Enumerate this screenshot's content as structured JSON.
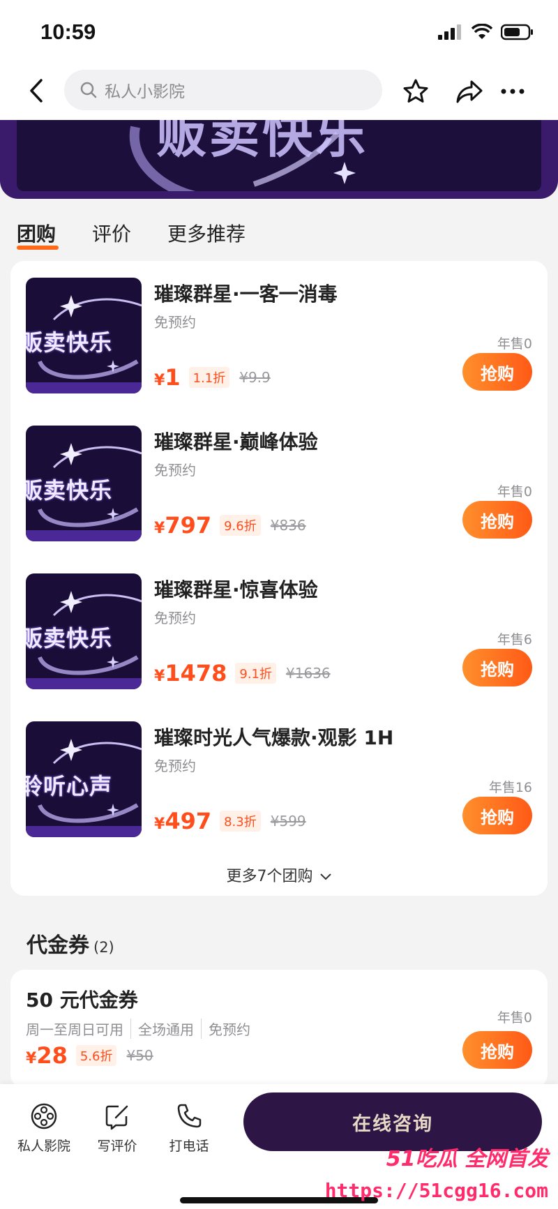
{
  "status_bar": {
    "time": "10:59"
  },
  "nav": {
    "search_placeholder": "私人小影院"
  },
  "banner": {
    "text": "贩卖快乐"
  },
  "tabs": [
    {
      "label": "团购",
      "active": true
    },
    {
      "label": "评价",
      "active": false
    },
    {
      "label": "更多推荐",
      "active": false
    }
  ],
  "deals": [
    {
      "title": "璀璨群星·一客一消毒",
      "subtitle": "免预约",
      "currency": "¥",
      "price": "1",
      "discount": "1.1折",
      "original": "¥9.9",
      "sold": "年售0",
      "button": "抢购",
      "thumb_text": "贩卖快乐"
    },
    {
      "title": "璀璨群星·巅峰体验",
      "subtitle": "免预约",
      "currency": "¥",
      "price": "797",
      "discount": "9.6折",
      "original": "¥836",
      "sold": "年售0",
      "button": "抢购",
      "thumb_text": "贩卖快乐"
    },
    {
      "title": "璀璨群星·惊喜体验",
      "subtitle": "免预约",
      "currency": "¥",
      "price": "1478",
      "discount": "9.1折",
      "original": "¥1636",
      "sold": "年售6",
      "button": "抢购",
      "thumb_text": "贩卖快乐"
    },
    {
      "title": "璀璨时光人气爆款·观影 1H",
      "subtitle": "免预约",
      "currency": "¥",
      "price": "497",
      "discount": "8.3折",
      "original": "¥599",
      "sold": "年售16",
      "button": "抢购",
      "thumb_text": "聆听心声"
    }
  ],
  "more_deals": "更多7个团购",
  "vouchers": {
    "heading": "代金券",
    "count": "(2)",
    "items": [
      {
        "title": "50 元代金券",
        "tags": [
          "周一至周日可用",
          "全场通用",
          "免预约"
        ],
        "currency": "¥",
        "price": "28",
        "discount": "5.6折",
        "original": "¥50",
        "sold": "年售0",
        "button": "抢购"
      }
    ]
  },
  "bottom_bar": {
    "items": [
      {
        "label": "私人影院",
        "icon": "film-reel-icon"
      },
      {
        "label": "写评价",
        "icon": "edit-review-icon"
      },
      {
        "label": "打电话",
        "icon": "phone-icon"
      }
    ],
    "consult": "在线咨询"
  },
  "watermark": {
    "line1": "51吃瓜 全网首发",
    "line2": "https://51cgg16.com"
  },
  "colors": {
    "accent": "#ff5a16",
    "price": "#ff4d1c",
    "consult_bg": "#2d1545",
    "thumb_bg": "#1a0d38"
  }
}
